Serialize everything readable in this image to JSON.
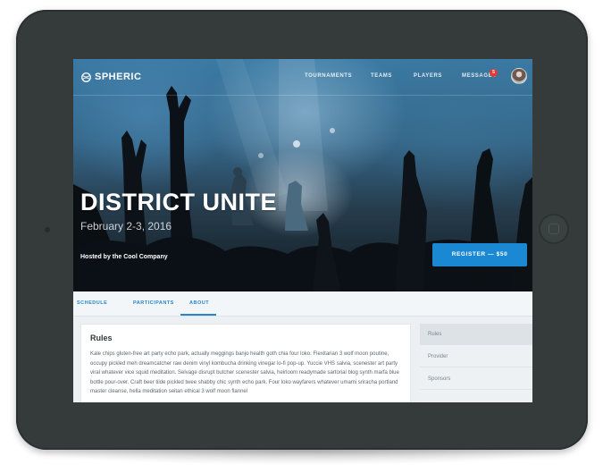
{
  "app": {
    "brand": "SPHERIC"
  },
  "nav": {
    "links": [
      "TOURNAMENTS",
      "TEAMS",
      "PLAYERS",
      "MESSAGES"
    ],
    "messages_badge": "5"
  },
  "event": {
    "title": "DISTRICT UNITE",
    "date": "February 2-3, 2016",
    "host": "Hosted by the Cool Company",
    "register_label": "REGISTER — $50"
  },
  "tabs": [
    "SCHEDULE",
    "PARTICIPANTS",
    "ABOUT"
  ],
  "active_tab": "ABOUT",
  "main": {
    "heading": "Rules",
    "body": "Kale chips gluten-free art party echo park, actually meggings banjo health goth chia four loko. Flexitarian 3 wolf moon poutine, occupy pickled meh dreamcatcher raw denim vinyl kombucha drinking vinegar lo-fi pop-up. Yuccie VHS salvia, scenester art party viral whatever vice squid meditation. Selvage disrupt butcher scenester salvia, heirloom readymade sartorial blog synth marfa blue bottle pour-over. Craft beer tilde pickled twee shabby chic synth echo park. Four loko wayfarers whatever umami sriracha portland master cleanse, hella meditation seitan ethical 3 wolf moon flannel"
  },
  "sidebar": {
    "items": [
      "Rules",
      "Provider",
      "Sponsors"
    ],
    "active": "Rules"
  },
  "colors": {
    "accent": "#1b88d4",
    "badge": "#e53935",
    "tablet_bezel": "#353b3b"
  }
}
